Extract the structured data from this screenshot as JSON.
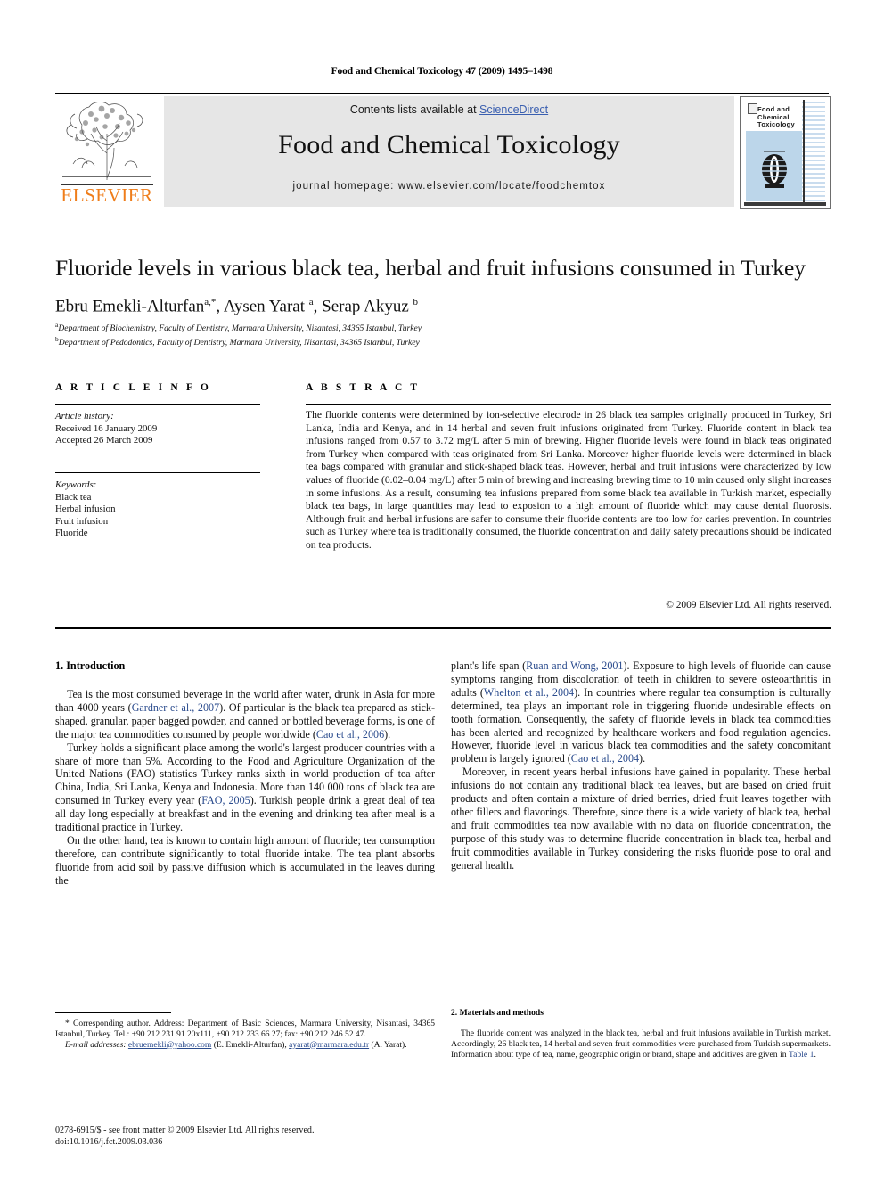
{
  "running_head": "Food and Chemical Toxicology 47 (2009) 1495–1498",
  "banner": {
    "contents_prefix": "Contents lists available at ",
    "sciencedirect": "ScienceDirect",
    "journal_name": "Food and Chemical Toxicology",
    "homepage": "journal homepage: www.elsevier.com/locate/foodchemtox",
    "publisher_logo_text": "ELSEVIER",
    "cover_title": "Food and Chemical Toxicology",
    "accent_link_color": "#3a5fb0",
    "elsevier_orange": "#ef7d1a",
    "cover_blue": "#bcd6ea"
  },
  "article": {
    "title": "Fluoride levels in various black tea, herbal and fruit infusions consumed in Turkey",
    "authors_html": "Ebru Emekli-Alturfan<sup>a,*</sup>, Aysen Yarat <sup>a</sup>, Serap Akyuz <sup>b</sup>",
    "affiliation_a": "Department of Biochemistry, Faculty of Dentistry, Marmara University, Nisantasi, 34365 Istanbul, Turkey",
    "affiliation_b": "Department of Pedodontics, Faculty of Dentistry, Marmara University, Nisantasi, 34365 Istanbul, Turkey"
  },
  "article_info": {
    "heading": "A R T I C L E    I N F O",
    "history_label": "Article history:",
    "received": "Received 16 January 2009",
    "accepted": "Accepted 26 March 2009",
    "keywords_label": "Keywords:",
    "keywords": [
      "Black tea",
      "Herbal infusion",
      "Fruit infusion",
      "Fluoride"
    ]
  },
  "abstract": {
    "heading": "A B S T R A C T",
    "text": "The fluoride contents were determined by ion-selective electrode in 26 black tea samples originally produced in Turkey, Sri Lanka, India and Kenya, and in 14 herbal and seven fruit infusions originated from Turkey. Fluoride content in black tea infusions ranged from 0.57 to 3.72 mg/L after 5 min of brewing. Higher fluoride levels were found in black teas originated from Turkey when compared with teas originated from Sri Lanka. Moreover higher fluoride levels were determined in black tea bags compared with granular and stick-shaped black teas. However, herbal and fruit infusions were characterized by low values of fluoride (0.02–0.04 mg/L) after 5 min of brewing and increasing brewing time to 10 min caused only slight increases in some infusions. As a result, consuming tea infusions prepared from some black tea available in Turkish market, especially black tea bags, in large quantities may lead to exposion to a high amount of fluoride which may cause dental fluorosis. Although fruit and herbal infusions are safer to consume their fluoride contents are too low for caries prevention. In countries such as Turkey where tea is traditionally consumed, the fluoride concentration and daily safety precautions should be indicated on tea products.",
    "copyright": "© 2009 Elsevier Ltd. All rights reserved."
  },
  "sections": {
    "introduction_heading": "1. Introduction",
    "materials_heading": "2. Materials and methods",
    "intro_left": [
      {
        "parts": [
          {
            "t": "Tea is the most consumed beverage in the world after water, drunk in Asia for more than 4000 years ("
          },
          {
            "t": "Gardner et al., 2007",
            "ref": true
          },
          {
            "t": "). Of particular is the black tea prepared as stick-shaped, granular, paper bagged powder, and canned or bottled beverage forms, is one of the major tea commodities consumed by people worldwide ("
          },
          {
            "t": "Cao et al., 2006",
            "ref": true
          },
          {
            "t": ")."
          }
        ]
      },
      {
        "parts": [
          {
            "t": "Turkey holds a significant place among the world's largest producer countries with a share of more than 5%. According to the Food and Agriculture Organization of the United Nations (FAO) statistics Turkey ranks sixth in world production of tea after China, India, Sri Lanka, Kenya and Indonesia. More than 140 000 tons of black tea are consumed in Turkey every year ("
          },
          {
            "t": "FAO, 2005",
            "ref": true
          },
          {
            "t": "). Turkish people drink a great deal of tea all day long especially at breakfast and in the evening and drinking tea after meal is a traditional practice in Turkey."
          }
        ]
      },
      {
        "parts": [
          {
            "t": "On the other hand, tea is known to contain high amount of fluoride; tea consumption therefore, can contribute significantly to total fluoride intake. The tea plant absorbs fluoride from acid soil by passive diffusion which is accumulated in the leaves during the"
          }
        ]
      }
    ],
    "intro_right": [
      {
        "parts": [
          {
            "t": "plant's life span ("
          },
          {
            "t": "Ruan and Wong, 2001",
            "ref": true
          },
          {
            "t": "). Exposure to high levels of fluoride can cause symptoms ranging from discoloration of teeth in children to severe osteoarthritis in adults ("
          },
          {
            "t": "Whelton et al., 2004",
            "ref": true
          },
          {
            "t": "). In countries where regular tea consumption is culturally determined, tea plays an important role in triggering fluoride undesirable effects on tooth formation. Consequently, the safety of fluoride levels in black tea commodities has been alerted and recognized by healthcare workers and food regulation agencies. However, fluoride level in various black tea commodities and the safety concomitant problem is largely ignored ("
          },
          {
            "t": "Cao et al., 2004",
            "ref": true
          },
          {
            "t": ")."
          }
        ],
        "noindent": true
      },
      {
        "parts": [
          {
            "t": "Moreover, in recent years herbal infusions have gained in popularity. These herbal infusions do not contain any traditional black tea leaves, but are based on dried fruit products and often contain a mixture of dried berries, dried fruit leaves together with other fillers and flavorings. Therefore, since there is a wide variety of black tea, herbal and fruit commodities tea now available with no data on fluoride concentration, the purpose of this study was to determine fluoride concentration in black tea, herbal and fruit commodities available in Turkey considering the risks fluoride pose to oral and general health."
          }
        ]
      }
    ],
    "materials_text": [
      {
        "parts": [
          {
            "t": "The fluoride content was analyzed in the black tea, herbal and fruit infusions available in Turkish market. Accordingly, 26 black tea, 14 herbal and seven fruit commodities were purchased from Turkish supermarkets. Information about type of tea, name, geographic origin or brand, shape and additives are given in "
          },
          {
            "t": "Table 1",
            "ref": true
          },
          {
            "t": "."
          }
        ]
      }
    ]
  },
  "footnotes": {
    "corresponding": "* Corresponding author. Address: Department of Basic Sciences, Marmara University, Nisantasi, 34365 Istanbul, Turkey. Tel.: +90 212 231 91 20x111, +90 212 233 66 27; fax: +90 212 246 52 47.",
    "email_label": "E-mail addresses:",
    "email_1": "ebruemekli@yahoo.com",
    "email_1_owner": " (E. Emekli-Alturfan), ",
    "email_2": "ayarat@marmara.edu.tr",
    "email_2_owner": " (A. Yarat).",
    "issn_line": "0278-6915/$ - see front matter © 2009 Elsevier Ltd. All rights reserved.",
    "doi_line": "doi:10.1016/j.fct.2009.03.036"
  }
}
